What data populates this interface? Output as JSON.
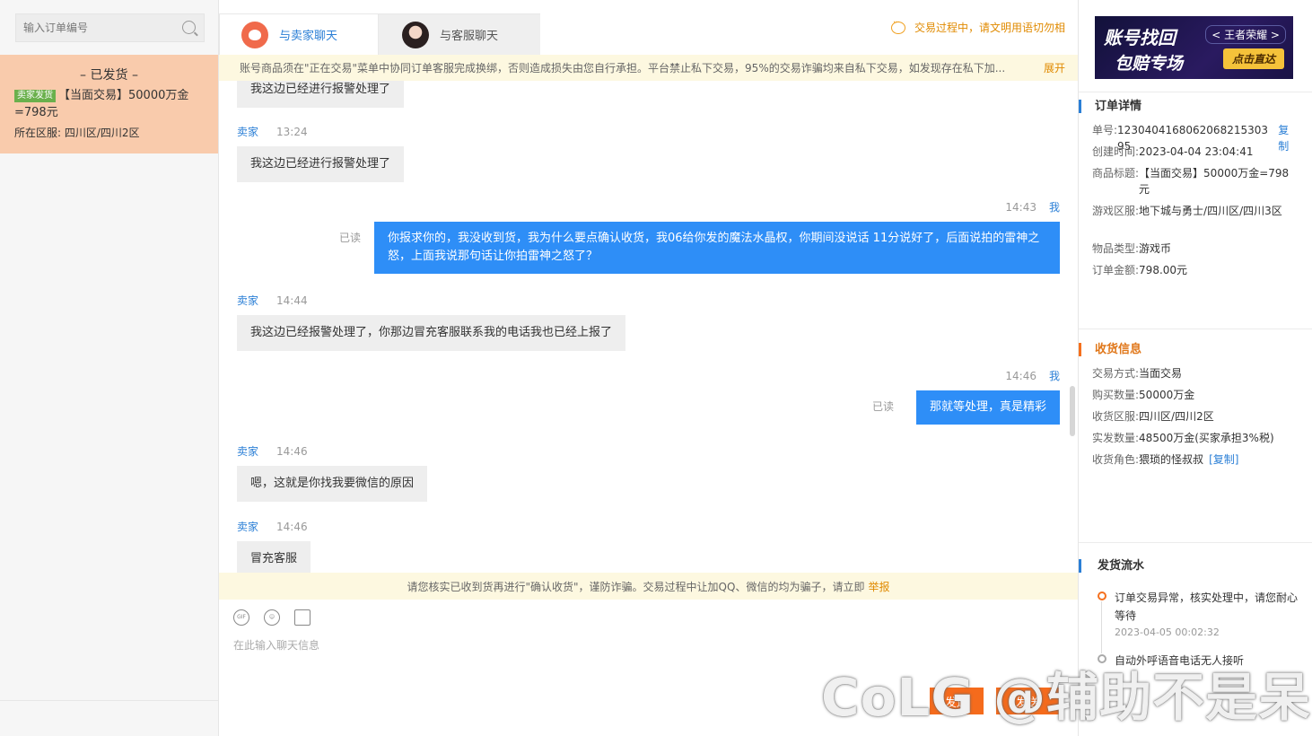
{
  "sidebar": {
    "search_placeholder": "输入订单编号",
    "order": {
      "status": "– 已发货 –",
      "badge": "卖家发货",
      "title": "【当面交易】50000万金=798元",
      "region_label": "所在区服:",
      "region_value": "四川区/四川2区"
    }
  },
  "tabs": [
    {
      "label": "与卖家聊天",
      "active": true
    },
    {
      "label": "与客服聊天",
      "active": false
    }
  ],
  "top_tip": "交易过程中，请文明用语切勿相",
  "notice_top": {
    "text": "账号商品须在\"正在交易\"菜单中协同订单客服完成换绑，否则造成损失由您自行承担。平台禁止私下交易，95%的交易诈骗均来自私下交易，如发现存在私下加...",
    "expand": "展开"
  },
  "messages": [
    {
      "side": "left",
      "text": "我这边已经进行报警处理了"
    },
    {
      "side": "left",
      "sender": "卖家",
      "time": "13:24",
      "text": "我这边已经进行报警处理了"
    },
    {
      "side": "right",
      "sender": "我",
      "time": "14:43",
      "read": "已读",
      "text": "你报求你的，我没收到货，我为什么要点确认收货，我06给你发的魔法水晶权，你期间没说话 11分说好了，后面说拍的雷神之怒，上面我说那句话让你拍雷神之怒了？"
    },
    {
      "side": "left",
      "sender": "卖家",
      "time": "14:44",
      "text": "我这边已经报警处理了，你那边冒充客服联系我的电话我也已经上报了"
    },
    {
      "side": "right",
      "sender": "我",
      "time": "14:46",
      "read": "已读",
      "text": "那就等处理，真是精彩"
    },
    {
      "side": "left",
      "sender": "卖家",
      "time": "14:46",
      "text": "嗯，这就是你找我要微信的原因"
    },
    {
      "side": "left",
      "sender": "卖家",
      "time": "14:46",
      "text": "冒充客服"
    }
  ],
  "notice_bottom": {
    "text": "请您核实已收到货再进行\"确认收货\"，谨防诈骗。交易过程中让加QQ、微信的均为骗子，请立即",
    "report": "举报"
  },
  "toolbar": {
    "gif": "GIF"
  },
  "input_placeholder": "在此输入聊天信息",
  "buttons": {
    "send_a": "发送",
    "send_b": "发送"
  },
  "banner": {
    "title": "账号找回",
    "sub": "包赔专场",
    "game": "< 王者荣耀 >",
    "cta": "点击直达"
  },
  "order_detail": {
    "section": "订单详情",
    "id_label": "单号:",
    "id_value": "1230404168062068215303​95",
    "copy": "复制",
    "created_label": "创建时间:",
    "created_value": "2023-04-04 23:04:41",
    "title_label": "商品标题:",
    "title_value": "【当面交易】50000万金=798元",
    "server_label": "游戏区服:",
    "server_value": "地下城与勇士/四川区/四川3区",
    "type_label": "物品类型:",
    "type_value": "游戏币",
    "amount_label": "订单金额:",
    "amount_value": "798.00",
    "amount_unit": "元"
  },
  "delivery_info": {
    "section": "收货信息",
    "method_label": "交易方式:",
    "method_value": "当面交易",
    "qty_label": "购买数量:",
    "qty_value": "50000万金",
    "region_label": "收货区服:",
    "region_value": "四川区/四川2区",
    "actual_label": "实发数量:",
    "actual_value": "48500",
    "actual_note": "万金(买家承担3%税)",
    "role_label": "收货角色:",
    "role_value": "猥琐的怪叔叔",
    "role_copy": "[复制]"
  },
  "delivery_flow": {
    "section": "发货流水",
    "items": [
      {
        "text": "订单交易异常，核实处理中，请您耐心等待",
        "time": "2023-04-05 00:02:32"
      },
      {
        "text": "自动外呼语音电话无人接听",
        "time": ""
      }
    ]
  },
  "watermark": "CoLG @辅助不是呆"
}
